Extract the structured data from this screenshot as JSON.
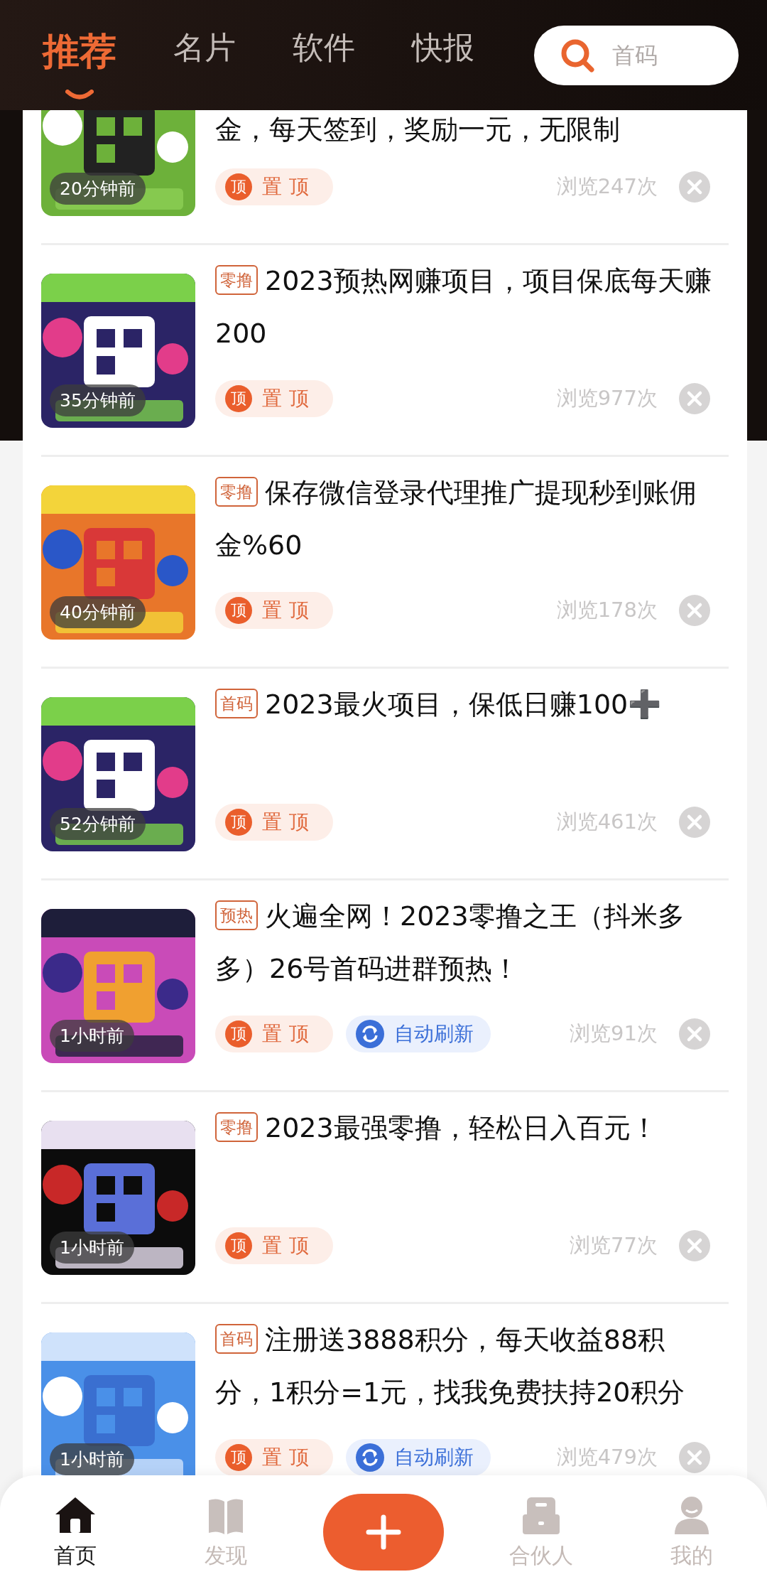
{
  "header": {
    "tabs": [
      {
        "label": "推荐",
        "selected": true
      },
      {
        "label": "名片",
        "selected": false
      },
      {
        "label": "软件",
        "selected": false
      },
      {
        "label": "快报",
        "selected": false
      }
    ],
    "search": {
      "placeholder": "首码"
    }
  },
  "posts": [
    {
      "continued": true,
      "time": "20分钟前",
      "title": "金，每天签到，奖励一元，无限制",
      "pin_badge": "顶",
      "pin": "置顶",
      "views": "浏览247次"
    },
    {
      "continued": false,
      "tag": "零撸",
      "time": "35分钟前",
      "title": "2023预热网赚项目，项目保底每天赚200",
      "pin_badge": "顶",
      "pin": "置顶",
      "views": "浏览977次"
    },
    {
      "continued": false,
      "tag": "零撸",
      "time": "40分钟前",
      "title": "保存微信登录代理推广提现秒到账佣金%60",
      "pin_badge": "顶",
      "pin": "置顶",
      "views": "浏览178次"
    },
    {
      "continued": false,
      "tag": "首码",
      "time": "52分钟前",
      "title": "2023最火项目，保低日赚100➕",
      "pin_badge": "顶",
      "pin": "置顶",
      "views": "浏览461次"
    },
    {
      "continued": false,
      "tag": "预热",
      "time": "1小时前",
      "title": "火遍全网！2023零撸之王（抖米多多）26号首码进群预热！",
      "pin_badge": "顶",
      "pin": "置顶",
      "refresh": "自动刷新",
      "views": "浏览91次"
    },
    {
      "continued": false,
      "tag": "零撸",
      "time": "1小时前",
      "title": "2023最强零撸，轻松日入百元！",
      "pin_badge": "顶",
      "pin": "置顶",
      "views": "浏览77次"
    },
    {
      "continued": false,
      "tag": "首码",
      "time": "1小时前",
      "title": "注册送3888积分，每天收益88积分，1积分=1元，找我免费扶持20积分",
      "pin_badge": "顶",
      "pin": "置顶",
      "refresh": "自动刷新",
      "views": "浏览479次"
    }
  ],
  "bottom_nav": [
    {
      "kind": "tab",
      "label": "首页",
      "selected": true
    },
    {
      "kind": "tab",
      "label": "发现",
      "selected": false
    },
    {
      "kind": "add"
    },
    {
      "kind": "tab",
      "label": "合伙人",
      "selected": false
    },
    {
      "kind": "tab",
      "label": "我的",
      "selected": false
    }
  ]
}
